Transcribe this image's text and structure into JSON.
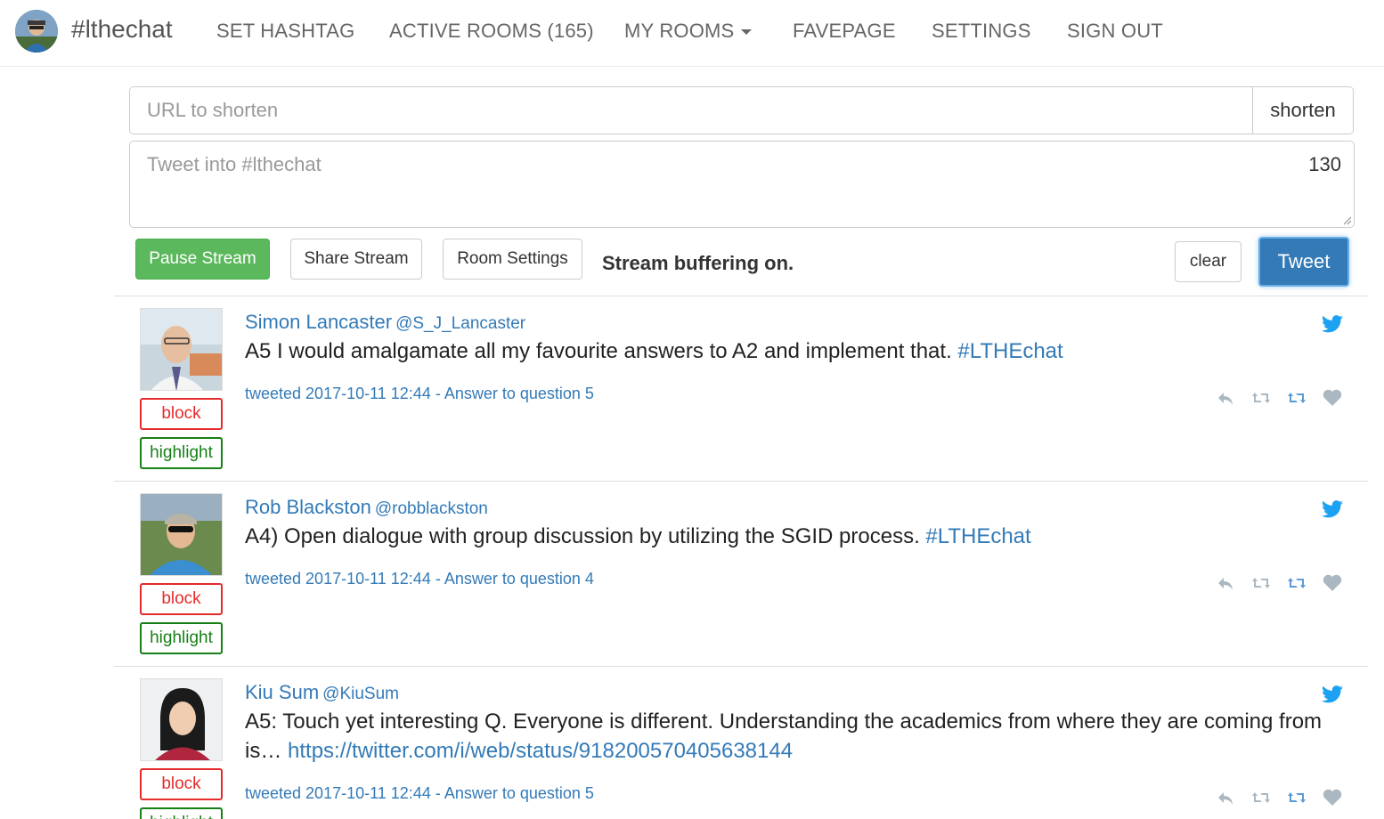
{
  "nav": {
    "brand": "#lthechat",
    "items": [
      {
        "label": "SET HASHTAG"
      },
      {
        "label": "ACTIVE ROOMS (165)"
      },
      {
        "label": "MY ROOMS"
      },
      {
        "label": "FAVEPAGE"
      },
      {
        "label": "SETTINGS"
      },
      {
        "label": "SIGN OUT"
      }
    ]
  },
  "composer": {
    "url_placeholder": "URL to shorten",
    "shorten_label": "shorten",
    "tweet_placeholder": "Tweet into #lthechat",
    "char_count": "130"
  },
  "toolbar": {
    "pause_label": "Pause Stream",
    "share_label": "Share Stream",
    "room_settings_label": "Room Settings",
    "status": "Stream buffering on.",
    "clear_label": "clear",
    "tweet_label": "Tweet"
  },
  "colors": {
    "link": "#337ab7",
    "success": "#5cb85c",
    "primary": "#337ab7",
    "block": "#e52b2b",
    "highlight": "#168016",
    "twitter": "#1da1f2"
  },
  "tweets": [
    {
      "name": "Simon Lancaster",
      "handle": "@S_J_Lancaster",
      "text": "A5 I would amalgamate all my favourite answers to A2 and implement that.",
      "link": "#LTHEchat",
      "meta": "tweeted 2017-10-11 12:44 - Answer to question 5",
      "block_label": "block",
      "highlight_label": "highlight"
    },
    {
      "name": "Rob Blackston",
      "handle": "@robblackston",
      "text": "A4) Open dialogue with group discussion by utilizing the SGID process.",
      "link": "#LTHEchat",
      "meta": "tweeted 2017-10-11 12:44 - Answer to question 4",
      "block_label": "block",
      "highlight_label": "highlight"
    },
    {
      "name": "Kiu Sum",
      "handle": "@KiuSum",
      "text": "A5: Touch yet interesting Q. Everyone is different. Understanding the academics from where they are coming from is…",
      "link": "https://twitter.com/i/web/status/918200570405638144",
      "meta": "tweeted 2017-10-11 12:44 - Answer to question 5",
      "block_label": "block",
      "highlight_label": "highlight"
    }
  ]
}
